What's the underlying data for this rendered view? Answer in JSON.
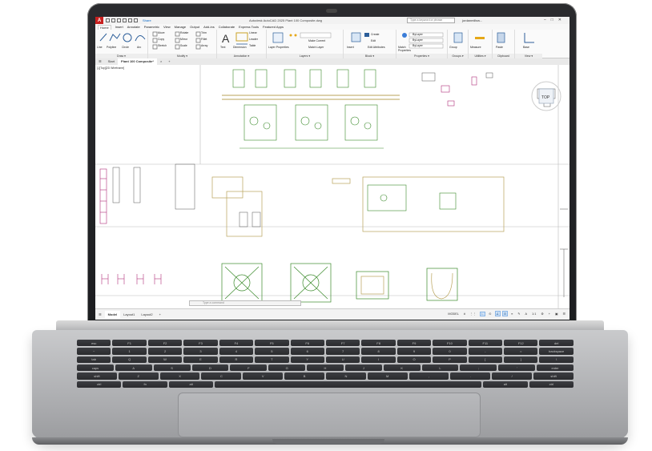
{
  "window": {
    "app_logo": "A",
    "title": "Autodesk AutoCAD 2025   Plant 100 Composite.dwg",
    "search_placeholder": "Type a keyword or phrase",
    "user": "jordanmillsw...",
    "share_label": "Share"
  },
  "menu": {
    "items": [
      "Home",
      "Insert",
      "Annotate",
      "Parametric",
      "View",
      "Manage",
      "Output",
      "Add-ins",
      "Collaborate",
      "Express Tools",
      "Featured Apps"
    ],
    "active": "Home"
  },
  "ribbon": {
    "groups": [
      {
        "label": "Draw ▾",
        "buttons": [
          "Line",
          "Polyline",
          "Circle",
          "Arc"
        ]
      },
      {
        "label": "Modify ▾",
        "buttons": [
          "Move",
          "Rotate",
          "Trim",
          "Copy",
          "Mirror",
          "Fillet",
          "Stretch",
          "Scale",
          "Array"
        ]
      },
      {
        "label": "Annotation ▾",
        "buttons": [
          "Text",
          "Dimension",
          "Linear",
          "Leader",
          "Table"
        ]
      },
      {
        "label": "Layers ▾",
        "buttons": [
          "Layer Properties",
          "Make Current",
          "Match Layer"
        ]
      },
      {
        "label": "Block ▾",
        "buttons": [
          "Insert",
          "Create",
          "Edit",
          "Edit Attributes"
        ]
      },
      {
        "label": "Properties ▾",
        "buttons": [
          "Match Properties",
          "ByLayer",
          "ByLayer",
          "ByLayer"
        ]
      },
      {
        "label": "Groups ▾",
        "buttons": [
          "Group"
        ]
      },
      {
        "label": "Utilities ▾",
        "buttons": [
          "Measure"
        ]
      },
      {
        "label": "Clipboard",
        "buttons": [
          "Paste"
        ]
      },
      {
        "label": "View ▾",
        "buttons": [
          "Base"
        ]
      }
    ]
  },
  "doc_tabs": {
    "items": [
      "Start",
      "Plant 100 Composite*"
    ],
    "active": "Plant 100 Composite*",
    "add": "+"
  },
  "viewport_label": "[-][Top][2D Wireframe]",
  "command_line": {
    "placeholder": "Type a command"
  },
  "layout_tabs": {
    "items": [
      "Model",
      "Layout1",
      "Layout2"
    ],
    "active": "Model",
    "add": "+"
  },
  "status_bar": {
    "mode": "MODEL",
    "scale": "1:1",
    "items": [
      "#",
      "⋮⋮",
      "∟",
      "⊙",
      "∠",
      "⊡",
      "≡",
      "✎",
      "A",
      "1:1",
      "⚙",
      "+",
      "▣",
      "☰"
    ]
  },
  "keyboard": {
    "labels": [
      "esc",
      "F1",
      "F2",
      "F3",
      "F4",
      "F5",
      "F6",
      "F7",
      "F8",
      "F9",
      "F10",
      "F11",
      "F12",
      "del",
      "~",
      "1",
      "2",
      "3",
      "4",
      "5",
      "6",
      "7",
      "8",
      "9",
      "0",
      "-",
      "=",
      "backspace",
      "tab",
      "Q",
      "W",
      "E",
      "R",
      "T",
      "Y",
      "U",
      "I",
      "O",
      "P",
      "[",
      "]",
      "\\",
      "caps",
      "A",
      "S",
      "D",
      "F",
      "G",
      "H",
      "J",
      "K",
      "L",
      ";",
      "'",
      "enter",
      "shift",
      "Z",
      "X",
      "C",
      "V",
      "B",
      "N",
      "M",
      ",",
      ".",
      "/",
      "shift",
      "ctrl",
      "fn",
      "alt",
      "",
      "alt",
      "ctrl"
    ]
  },
  "colors": {
    "autocad_red": "#c8201f",
    "drawing_green": "#3a8a2a",
    "drawing_magenta": "#b0307a",
    "drawing_olive": "#b9a35a",
    "status_active": "#cfe2f7"
  }
}
